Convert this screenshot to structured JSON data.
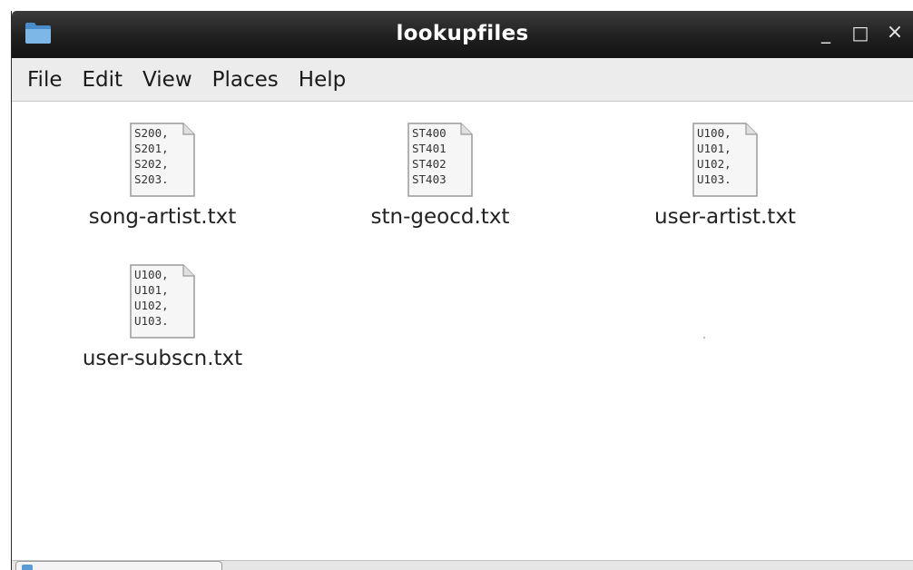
{
  "window": {
    "title": "lookupfiles",
    "controls": {
      "minimize": "_",
      "maximize": "□",
      "close": "×"
    }
  },
  "menubar": {
    "items": [
      "File",
      "Edit",
      "View",
      "Places",
      "Help"
    ]
  },
  "files": [
    {
      "name": "song-artist.txt",
      "icon": "text-file-icon",
      "preview": [
        "S200,",
        "S201,",
        "S202,",
        "S203."
      ]
    },
    {
      "name": "stn-geocd.txt",
      "icon": "text-file-icon",
      "preview": [
        "ST400",
        "ST401",
        "ST402",
        "ST403"
      ]
    },
    {
      "name": "user-artist.txt",
      "icon": "text-file-icon",
      "preview": [
        "U100,",
        "U101,",
        "U102,",
        "U103."
      ]
    },
    {
      "name": "user-subscn.txt",
      "icon": "text-file-icon",
      "preview": [
        "U100,",
        "U101,",
        "U102,",
        "U103."
      ]
    }
  ],
  "colors": {
    "titlebar": "#1e1e1e",
    "menubar": "#ececec",
    "folder_icon": "#5a9bd5"
  }
}
